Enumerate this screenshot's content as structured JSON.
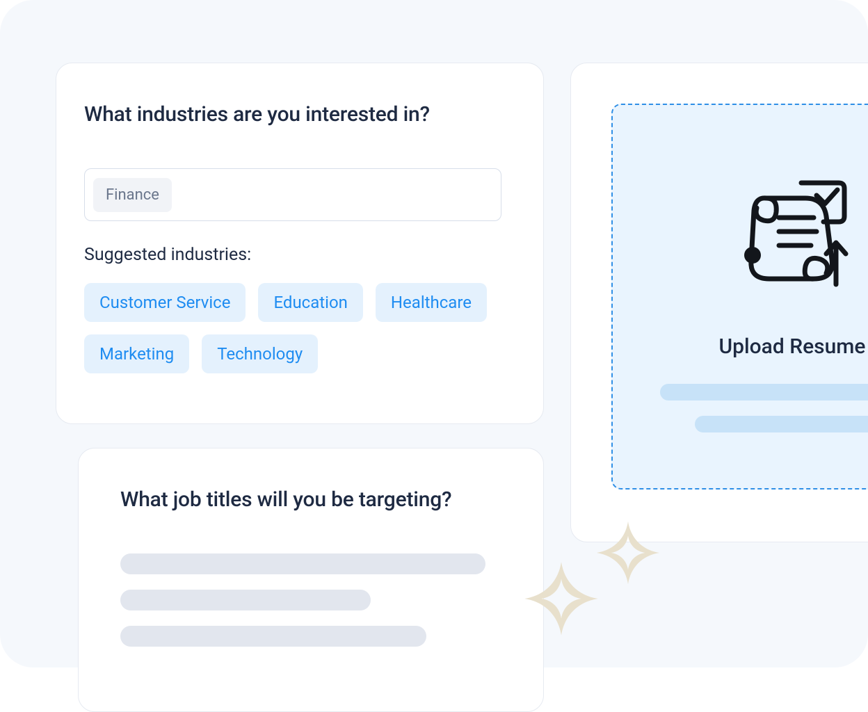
{
  "industries_card": {
    "question": "What industries are you interested in?",
    "selected_chip": "Finance",
    "suggested_label": "Suggested industries:",
    "suggestions": [
      "Customer Service",
      "Education",
      "Healthcare",
      "Marketing",
      "Technology"
    ]
  },
  "jobtitles_card": {
    "question": "What job titles will you be targeting?"
  },
  "upload_card": {
    "title": "Upload Resume"
  }
}
